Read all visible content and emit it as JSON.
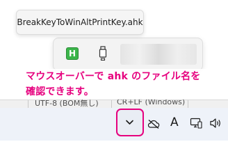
{
  "tooltip": {
    "text": "BreakKeyToWinAltPrintKey.ahk"
  },
  "overflow": {
    "items": [
      {
        "icon": "autohotkey-icon",
        "glyph": "H"
      },
      {
        "icon": "usb-icon"
      }
    ]
  },
  "annotation": {
    "line1": "マウスオーバーで ahk のファイル名を",
    "line2": "確認できます。",
    "color": "#e6007e"
  },
  "statusbar": {
    "encoding": "UTF-8 (BOM無し)",
    "line_ending": "CR+LF (Windows)"
  },
  "taskbar": {
    "ime_label": "A",
    "icons": [
      "chevron-up-icon",
      "cloud-off-icon",
      "ime-icon",
      "network-icon",
      "volume-icon"
    ]
  }
}
